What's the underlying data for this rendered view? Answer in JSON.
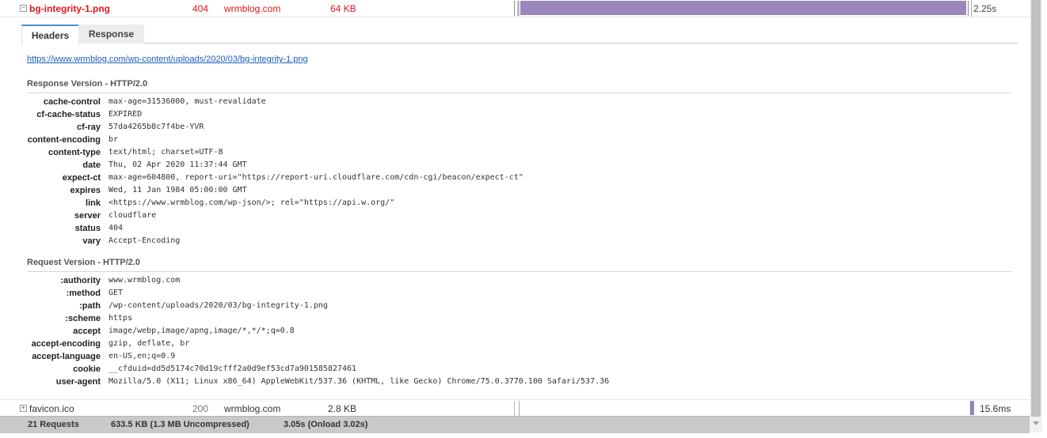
{
  "top_request": {
    "name": "bg-integrity-1.png",
    "status": "404",
    "domain": "wrmblog.com",
    "size": "64 KB",
    "time": "2.25s",
    "toggle": "−"
  },
  "tabs": {
    "headers": "Headers",
    "response": "Response"
  },
  "url": "https://www.wrmblog.com/wp-content/uploads/2020/03/bg-integrity-1.png",
  "response_section": {
    "title": "Response Version - HTTP/2.0",
    "headers": [
      {
        "key": "cache-control",
        "value": "max-age=31536000, must-revalidate"
      },
      {
        "key": "cf-cache-status",
        "value": "EXPIRED"
      },
      {
        "key": "cf-ray",
        "value": "57da4265b8c7f4be-YVR"
      },
      {
        "key": "content-encoding",
        "value": "br"
      },
      {
        "key": "content-type",
        "value": "text/html; charset=UTF-8"
      },
      {
        "key": "date",
        "value": "Thu, 02 Apr 2020 11:37:44 GMT"
      },
      {
        "key": "expect-ct",
        "value": "max-age=604800, report-uri=\"https://report-uri.cloudflare.com/cdn-cgi/beacon/expect-ct\""
      },
      {
        "key": "expires",
        "value": "Wed, 11 Jan 1984 05:00:00 GMT"
      },
      {
        "key": "link",
        "value": "<https://www.wrmblog.com/wp-json/>; rel=\"https://api.w.org/\""
      },
      {
        "key": "server",
        "value": "cloudflare"
      },
      {
        "key": "status",
        "value": "404"
      },
      {
        "key": "vary",
        "value": "Accept-Encoding"
      }
    ]
  },
  "request_section": {
    "title": "Request Version - HTTP/2.0",
    "headers": [
      {
        "key": ":authority",
        "value": "www.wrmblog.com"
      },
      {
        "key": ":method",
        "value": "GET"
      },
      {
        "key": ":path",
        "value": "/wp-content/uploads/2020/03/bg-integrity-1.png"
      },
      {
        "key": ":scheme",
        "value": "https"
      },
      {
        "key": "accept",
        "value": "image/webp,image/apng,image/*,*/*;q=0.8"
      },
      {
        "key": "accept-encoding",
        "value": "gzip, deflate, br"
      },
      {
        "key": "accept-language",
        "value": "en-US,en;q=0.9"
      },
      {
        "key": "cookie",
        "value": "__cfduid=dd5d5174c70d19cfff2a0d9ef53cd7a901585827461"
      },
      {
        "key": "user-agent",
        "value": "Mozilla/5.0 (X11; Linux x86_64) AppleWebKit/537.36 (KHTML, like Gecko) Chrome/75.0.3770.100 Safari/537.36"
      }
    ]
  },
  "bottom_request": {
    "name": "favicon.ico",
    "status": "200",
    "domain": "wrmblog.com",
    "size": "2.8 KB",
    "time": "15.6ms",
    "toggle": "+"
  },
  "status_bar": {
    "requests": "21 Requests",
    "size": "633.5 KB  (1.3 MB Uncompressed)",
    "time": "3.05s  (Onload 3.02s)"
  },
  "colors": {
    "error": "#e0161d",
    "bar": "#9a86bd",
    "link": "#1a5dbf",
    "tab_accent": "#4a90c8"
  }
}
